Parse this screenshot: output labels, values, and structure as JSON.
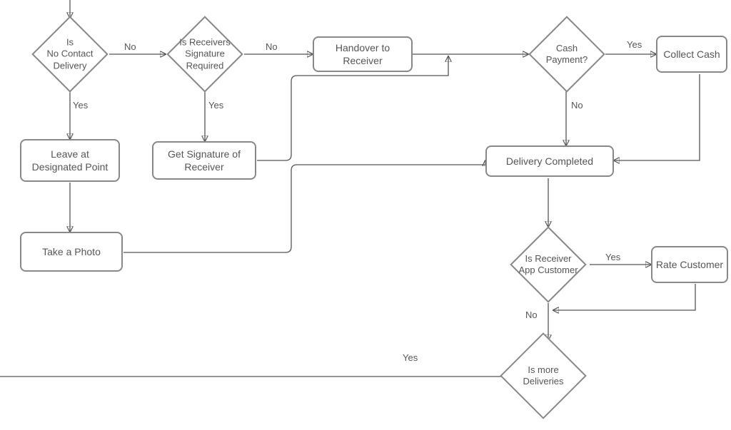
{
  "nodes": {
    "is_no_contact": "Is\nNo Contact\nDelivery",
    "is_sig_req": "Is Receivers\nSignature\nRequired",
    "handover": "Handover to Receiver",
    "cash_payment": "Cash\nPayment?",
    "collect_cash": "Collect Cash",
    "leave_point": "Leave at Designated Point",
    "get_sig": "Get Signature of Receiver",
    "delivery_completed": "Delivery Completed",
    "take_photo": "Take a Photo",
    "is_app_customer": "Is Receiver\nApp Customer",
    "rate_customer": "Rate Customer",
    "is_more_deliveries": "Is more\nDeliveries"
  },
  "edge_labels": {
    "no": "No",
    "yes": "Yes"
  }
}
